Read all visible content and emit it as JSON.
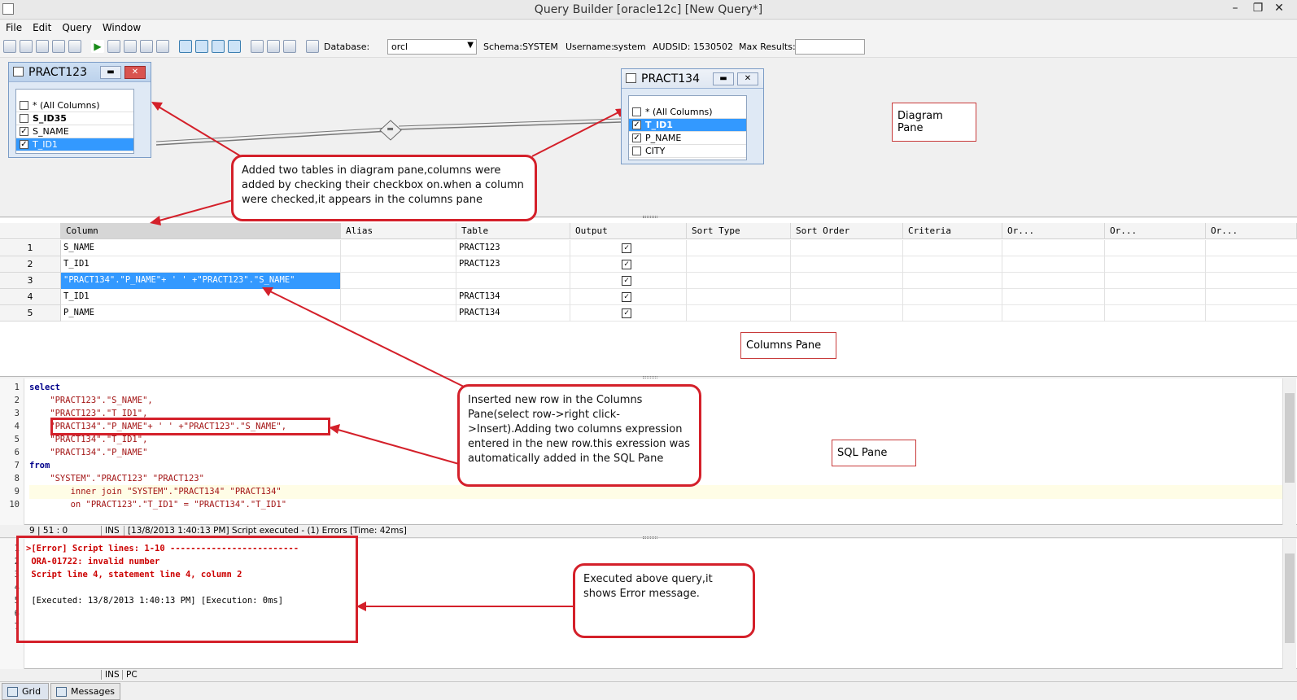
{
  "window": {
    "title": "Query Builder [oracle12c] [New Query*]"
  },
  "menu": [
    "File",
    "Edit",
    "Query",
    "Window"
  ],
  "toolbar": {
    "database_label": "Database:",
    "database_value": "orcl",
    "schema_label": "Schema:",
    "schema_value": "SYSTEM",
    "username_label": "Username:",
    "username_value": "system",
    "audsid_label": "AUDSID:",
    "audsid_value": "1530502",
    "max_results_label": "Max Results:",
    "max_results_value": ""
  },
  "diagram": {
    "table1": {
      "name": "PRACT123",
      "columns": [
        "* (All Columns)",
        "S_ID35",
        "S_NAME",
        "T_ID1"
      ],
      "checked": [
        false,
        false,
        true,
        true
      ]
    },
    "table2": {
      "name": "PRACT134",
      "columns": [
        "* (All Columns)",
        "T_ID1",
        "P_NAME",
        "CITY"
      ],
      "checked": [
        false,
        true,
        true,
        false
      ]
    },
    "join_symbol": "=",
    "pane_label": "Diagram Pane",
    "callout": "Added two tables in diagram pane,columns were added by checking their checkbox on.when a column were checked,it appears in the columns pane"
  },
  "columns_pane": {
    "headers": [
      "Column",
      "Alias",
      "Table",
      "Output",
      "Sort Type",
      "Sort Order",
      "Criteria",
      "Or...",
      "Or...",
      "Or..."
    ],
    "rows": [
      {
        "num": "1",
        "column": "S_NAME",
        "table": "PRACT123",
        "output": true
      },
      {
        "num": "2",
        "column": "T_ID1",
        "table": "PRACT123",
        "output": true
      },
      {
        "num": "3",
        "column": "\"PRACT134\".\"P_NAME\"+ ' ' +\"PRACT123\".\"S_NAME\"",
        "table": "",
        "output": true
      },
      {
        "num": "4",
        "column": "T_ID1",
        "table": "PRACT134",
        "output": true
      },
      {
        "num": "5",
        "column": "P_NAME",
        "table": "PRACT134",
        "output": true
      }
    ],
    "pane_label": "Columns Pane"
  },
  "sql_pane": {
    "lines": [
      "1",
      "2",
      "3",
      "4",
      "5",
      "6",
      "7",
      "8",
      "9",
      "10"
    ],
    "code": [
      "select",
      "    \"PRACT123\".\"S_NAME\",",
      "    \"PRACT123\".\"T_ID1\",",
      "    \"PRACT134\".\"P_NAME\"+ ' ' +\"PRACT123\".\"S_NAME\",",
      "    \"PRACT134\".\"T_ID1\",",
      "    \"PRACT134\".\"P_NAME\"",
      "from",
      "    \"SYSTEM\".\"PRACT123\" \"PRACT123\"",
      "        inner join \"SYSTEM\".\"PRACT134\" \"PRACT134\"",
      "        on \"PRACT123\".\"T_ID1\" = \"PRACT134\".\"T_ID1\""
    ],
    "pane_label": "SQL Pane",
    "callout": "Inserted new row in the Columns Pane(select row->right click->Insert).Adding two columns expression entered in the new row.this exression was automatically added in the SQL Pane"
  },
  "status": {
    "position": "9 | 51 : 0",
    "mode": "INS",
    "message": "[13/8/2013 1:40:13 PM] Script executed - (1) Errors [Time: 42ms]"
  },
  "messages": {
    "lines": [
      "1",
      "2",
      "3",
      "4",
      "5",
      "6",
      "7"
    ],
    "text": [
      ">[Error] Script lines: 1-10 -------------------------",
      " ORA-01722: invalid number",
      " Script line 4, statement line 4, column 2",
      "",
      " [Executed: 13/8/2013 1:40:13 PM] [Execution: 0ms]",
      "",
      ""
    ],
    "callout": "Executed above query,it shows Error message."
  },
  "bottom_status": {
    "mode": "INS",
    "pc": "PC"
  },
  "tabs": [
    "Grid",
    "Messages"
  ],
  "colors": {
    "accent": "#3399ff",
    "callout_border": "#d4202a",
    "error": "#cc0000"
  }
}
